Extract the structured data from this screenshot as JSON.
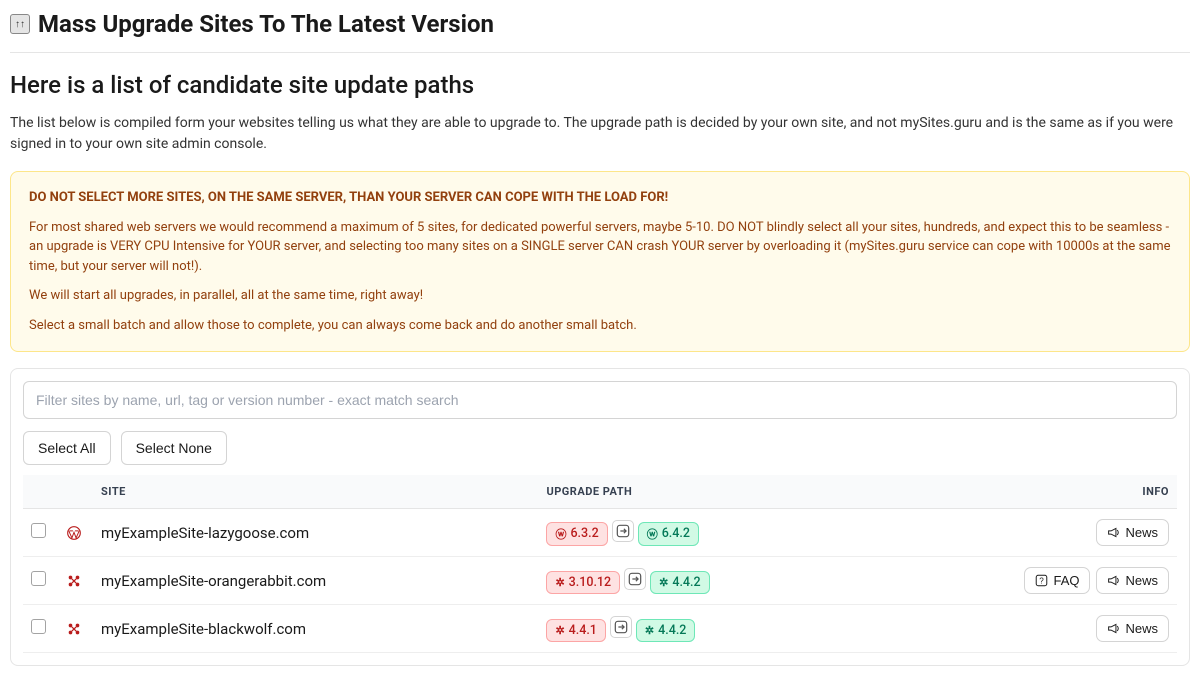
{
  "page_title": "Mass Upgrade Sites To The Latest Version",
  "subheading": "Here is a list of candidate site update paths",
  "intro": "The list below is compiled form your websites telling us what they are able to upgrade to. The upgrade path is decided by your own site, and not mySites.guru and is the same as if you were signed in to your own site admin console.",
  "warning": {
    "line1": "DO NOT SELECT MORE SITES, ON THE SAME SERVER, THAN YOUR SERVER CAN COPE WITH THE LOAD FOR!",
    "line2": "For most shared web servers we would recommend a maximum of 5 sites, for dedicated powerful servers, maybe 5-10. DO NOT blindly select all your sites, hundreds, and expect this to be seamless - an upgrade is VERY CPU Intensive for YOUR server, and selecting too many sites on a SINGLE server CAN crash YOUR server by overloading it (mySites.guru service can cope with 10000s at the same time, but your server will not!).",
    "line3": "We will start all upgrades, in parallel, all at the same time, right away!",
    "line4": "Select a small batch and allow those to complete, you can always come back and do another small batch."
  },
  "filter_placeholder": "Filter sites by name, url, tag or version number - exact match search",
  "buttons": {
    "select_all": "Select All",
    "select_none": "Select None"
  },
  "columns": {
    "site": "SITE",
    "path": "UPGRADE PATH",
    "info": "INFO"
  },
  "labels": {
    "faq": "FAQ",
    "news": "News"
  },
  "rows": [
    {
      "cms": "wordpress",
      "name": "myExampleSite-lazygoose.com",
      "from": "6.3.2",
      "to": "6.4.2",
      "faq": false,
      "news": true
    },
    {
      "cms": "joomla",
      "name": "myExampleSite-orangerabbit.com",
      "from": "3.10.12",
      "to": "4.4.2",
      "faq": true,
      "news": true
    },
    {
      "cms": "joomla",
      "name": "myExampleSite-blackwolf.com",
      "from": "4.4.1",
      "to": "4.4.2",
      "faq": false,
      "news": true
    }
  ]
}
